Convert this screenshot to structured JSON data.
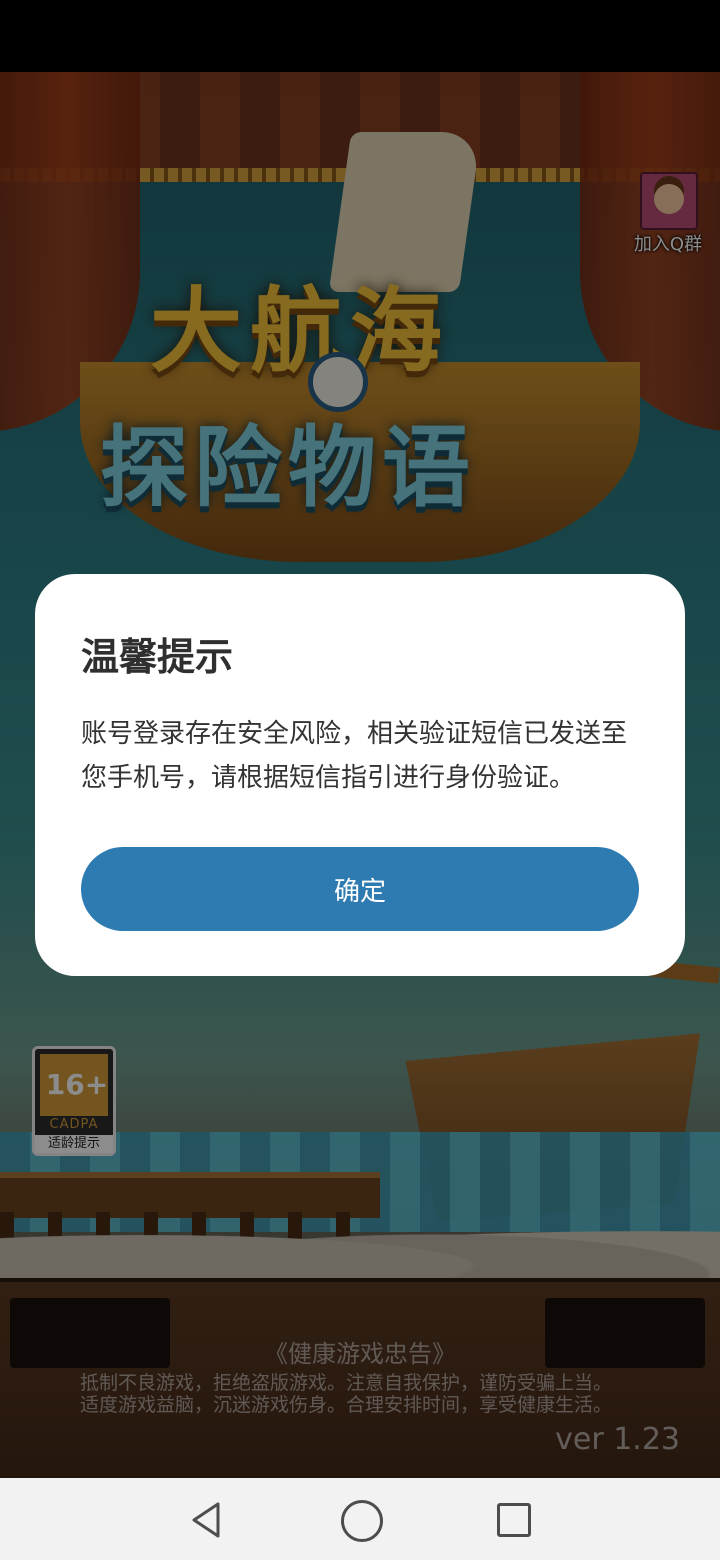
{
  "game": {
    "logo_title": "大航海",
    "logo_subtitle": "探险物语",
    "qq_group_label": "加入Q群",
    "rating": {
      "age": "16+",
      "org": "CADPA",
      "tip": "适龄提示"
    },
    "health_notice_title": "《健康游戏忠告》",
    "health_notice_line1": "抵制不良游戏，拒绝盗版游戏。注意自我保护，谨防受骗上当。",
    "health_notice_line2": "适度游戏益脑，沉迷游戏伤身。合理安排时间，享受健康生活。",
    "version": "ver 1.23"
  },
  "dialog": {
    "title": "温馨提示",
    "message": "账号登录存在安全风险，相关验证短信已发送至您手机号，请根据短信指引进行身份验证。",
    "confirm_label": "确定",
    "accent_color": "#2e7bb2"
  },
  "navbar": {
    "back_icon": "back-icon",
    "home_icon": "home-icon",
    "recents_icon": "recents-icon"
  }
}
